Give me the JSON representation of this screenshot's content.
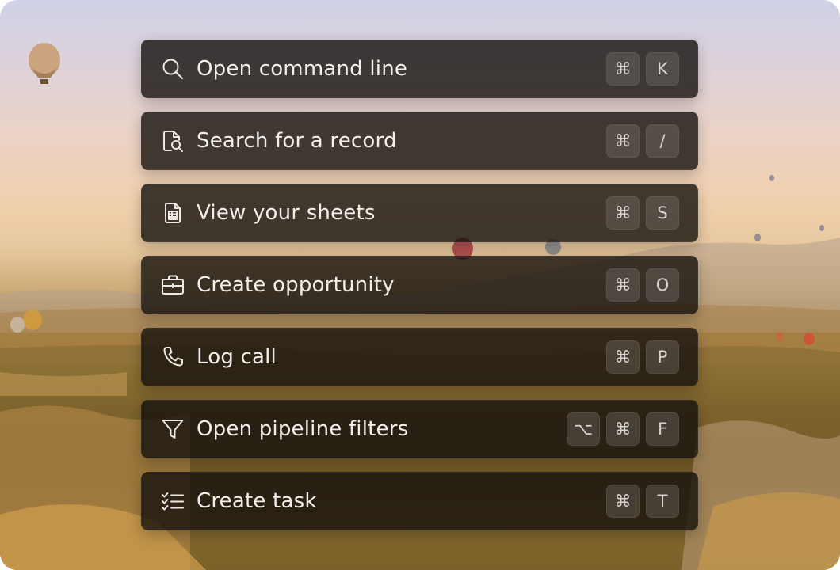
{
  "commands": [
    {
      "label": "Open command line",
      "icon": "search-icon",
      "keys": [
        "⌘",
        "K"
      ]
    },
    {
      "label": "Search for a record",
      "icon": "document-search-icon",
      "keys": [
        "⌘",
        "/"
      ]
    },
    {
      "label": "View your sheets",
      "icon": "spreadsheet-icon",
      "keys": [
        "⌘",
        "S"
      ]
    },
    {
      "label": "Create opportunity",
      "icon": "briefcase-icon",
      "keys": [
        "⌘",
        "O"
      ]
    },
    {
      "label": "Log call",
      "icon": "phone-icon",
      "keys": [
        "⌘",
        "P"
      ]
    },
    {
      "label": "Open pipeline filters",
      "icon": "filter-icon",
      "keys": [
        "⌥",
        "⌘",
        "F"
      ]
    },
    {
      "label": "Create task",
      "icon": "checklist-icon",
      "keys": [
        "⌘",
        "T"
      ]
    }
  ],
  "colors": {
    "row_background": "#14100d",
    "label_text": "#f2efec",
    "key_background": "#78736e",
    "key_text": "#d6d2cf"
  }
}
